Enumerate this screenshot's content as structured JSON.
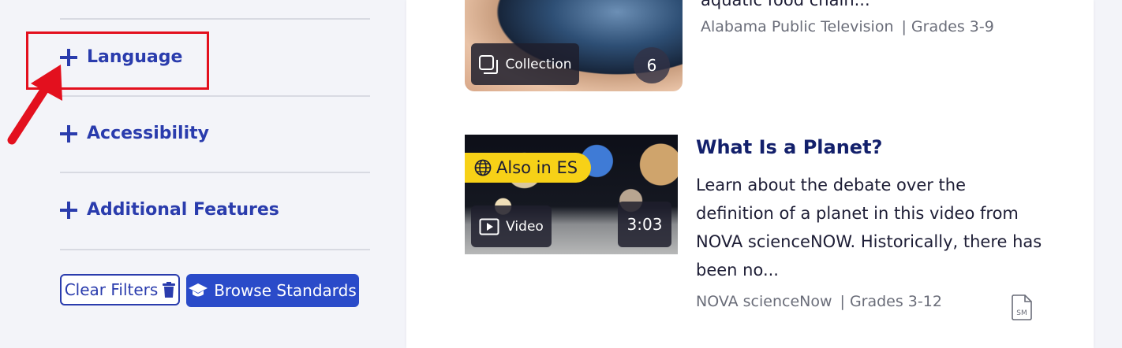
{
  "sidebar": {
    "filters": [
      {
        "label": "Language"
      },
      {
        "label": "Accessibility"
      },
      {
        "label": "Additional Features"
      }
    ],
    "clear_filters_label": "Clear Filters",
    "browse_standards_label": "Browse Standards"
  },
  "results": [
    {
      "title_partial": "aquatic food chain...",
      "media_type": "Collection",
      "count": "6",
      "source": "Alabama Public Television",
      "separator": "|",
      "grades": "Grades 3-9"
    },
    {
      "title": "What Is a Planet?",
      "language_tag": "Also in ES",
      "media_type": "Video",
      "duration": "3:03",
      "description": "Learn about the debate over the definition of a planet in this video from NOVA scienceNOW. Historically, there has been no...",
      "source": "NOVA scienceNow",
      "separator": "|",
      "grades": "Grades 3-12",
      "badge_icon_text": "SM"
    }
  ],
  "colors": {
    "accent": "#2a3cad",
    "highlight": "#e3101e",
    "language_tag": "#f7d117"
  }
}
